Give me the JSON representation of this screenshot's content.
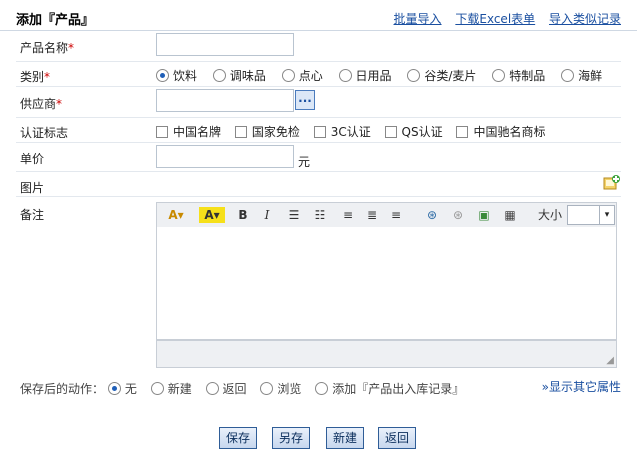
{
  "header": {
    "title": "添加『产品』",
    "links": [
      "批量导入",
      "下载Excel表单",
      "导入类似记录"
    ]
  },
  "fields": {
    "name_label": "产品名称",
    "category_label": "类别",
    "supplier_label": "供应商",
    "cert_label": "认证标志",
    "price_label": "单价",
    "price_unit": "元",
    "image_label": "图片",
    "remark_label": "备注"
  },
  "categories": [
    {
      "label": "饮料",
      "checked": true
    },
    {
      "label": "调味品",
      "checked": false
    },
    {
      "label": "点心",
      "checked": false
    },
    {
      "label": "日用品",
      "checked": false
    },
    {
      "label": "谷类/麦片",
      "checked": false
    },
    {
      "label": "特制品",
      "checked": false
    },
    {
      "label": "海鲜",
      "checked": false
    }
  ],
  "certifications": [
    "中国名牌",
    "国家免检",
    "3C认证",
    "QS认证",
    "中国驰名商标"
  ],
  "supplier": {
    "browse_label": "..."
  },
  "editor": {
    "size_label": "大小"
  },
  "after_save": {
    "label": "保存后的动作：",
    "options": [
      {
        "label": "无",
        "checked": true
      },
      {
        "label": "新建",
        "checked": false
      },
      {
        "label": "返回",
        "checked": false
      },
      {
        "label": "浏览",
        "checked": false
      },
      {
        "label": "添加『产品出入库记录』",
        "checked": false
      }
    ]
  },
  "show_more": "显示其它属性",
  "buttons": [
    "保存",
    "另存",
    "新建",
    "返回"
  ]
}
